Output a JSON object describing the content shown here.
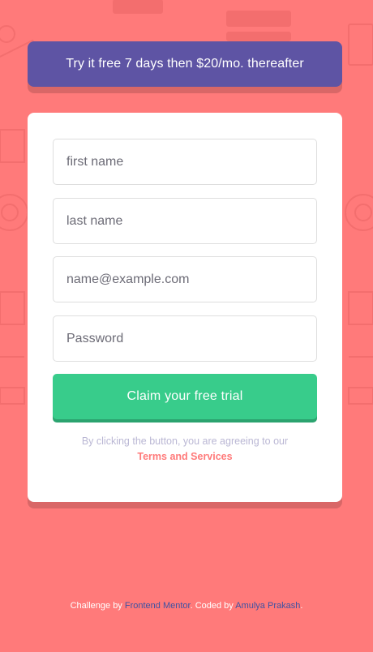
{
  "promo": {
    "text": "Try it free 7 days then $20/mo. thereafter"
  },
  "form": {
    "first_name_placeholder": "first name",
    "last_name_placeholder": "last name",
    "email_placeholder": "name@example.com",
    "password_placeholder": "Password",
    "submit_label": "Claim your free trial",
    "terms_prefix": "By clicking the button, you are agreeing to our",
    "terms_link": "Terms and Services"
  },
  "footer": {
    "challenge_prefix": "Challenge by",
    "challenge_link": "Frontend Mentor",
    "coded_prefix": ". Coded by",
    "coded_link": "Amulya Prakash",
    "suffix": "."
  },
  "colors": {
    "background": "#ff7a7a",
    "banner": "#5e54a4",
    "button": "#38cc8b",
    "terms_text": "#bab7d4",
    "link": "#3e52a3"
  }
}
